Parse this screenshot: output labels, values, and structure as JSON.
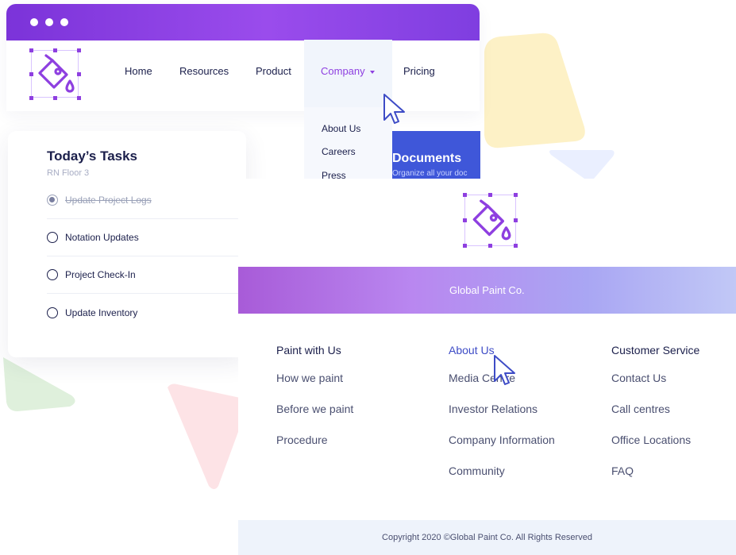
{
  "nav": {
    "items": [
      "Home",
      "Resources",
      "Product",
      "Company",
      "Pricing"
    ],
    "active": "Company"
  },
  "dropdown": {
    "items": [
      "About Us",
      "Careers",
      "Press"
    ]
  },
  "documents": {
    "title": "Documents",
    "subtitle": "Organize all your doc"
  },
  "tasks": {
    "title": "Today’s Tasks",
    "subtitle": "RN Floor 3",
    "items": [
      {
        "label": "Update Project Logs",
        "done": true
      },
      {
        "label": "Notation Updates",
        "done": false
      },
      {
        "label": "Project Check-In",
        "done": false
      },
      {
        "label": "Update Inventory",
        "done": false
      }
    ]
  },
  "footer": {
    "brand": "Global Paint Co.",
    "columns": [
      {
        "heading": "Paint with Us",
        "links": [
          "How we paint",
          "Before we paint",
          "Procedure"
        ]
      },
      {
        "heading": "About Us",
        "links": [
          "Media Centre",
          "Investor Relations",
          "Company Information",
          "Community"
        ]
      },
      {
        "heading": "Customer Service",
        "links": [
          "Contact Us",
          "Call centres",
          "Office Locations",
          "FAQ"
        ]
      }
    ],
    "copyright": "Copyright 2020 ©Global Paint Co. All Rights Reserved"
  },
  "colors": {
    "accent": "#8e3fe0",
    "navy": "#1b1f4b",
    "documents_bg": "#3f57d9"
  },
  "icons": [
    "paint-bucket-logo-icon",
    "cursor-icon"
  ]
}
